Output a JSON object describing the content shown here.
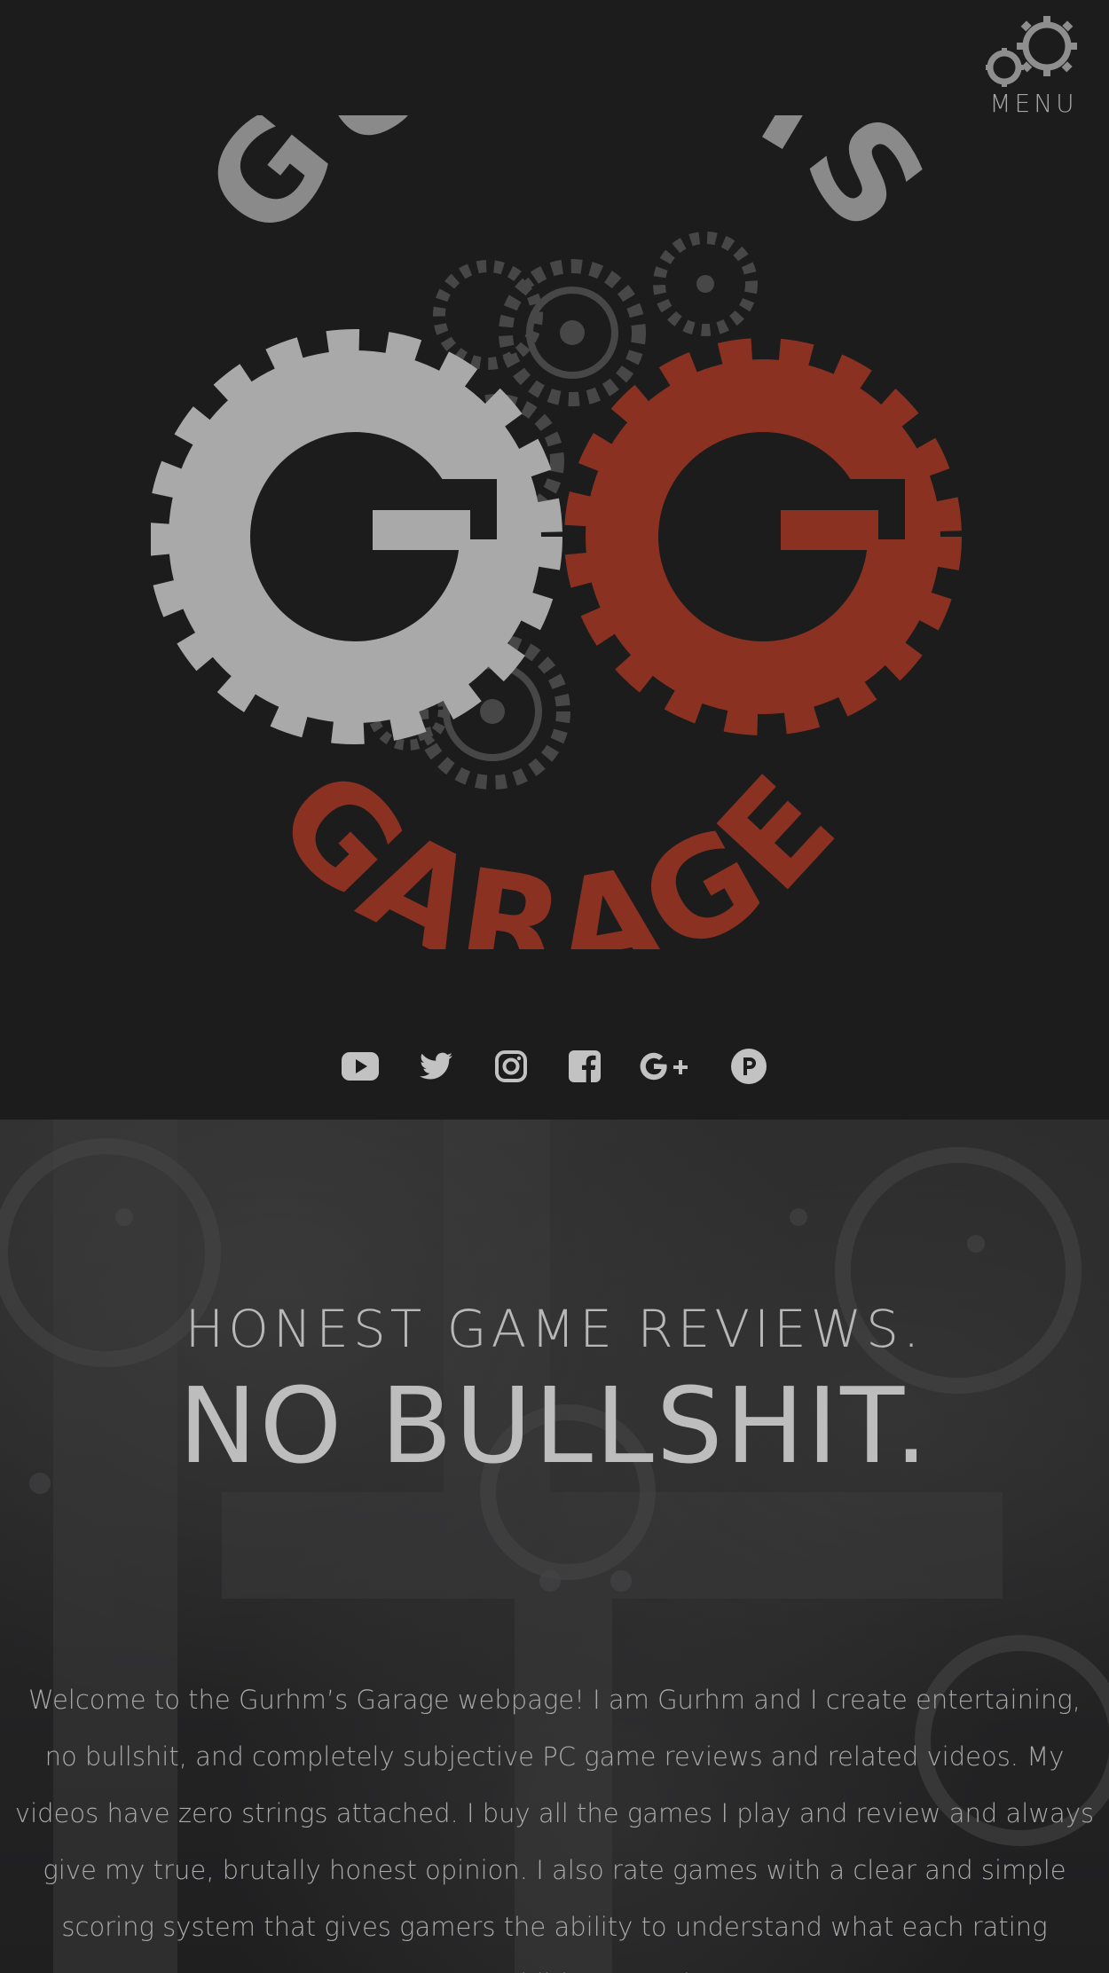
{
  "header": {
    "menu_label": "MENU",
    "menu_icon": "gears-icon"
  },
  "logo": {
    "top_text": "GURHMS",
    "bottom_text": "GARAGE",
    "monogram": "GG",
    "colors": {
      "grey": "#8a8a8a",
      "light_grey": "#a9a9a9",
      "red": "#8a3122",
      "dark_gear": "#474747"
    }
  },
  "social": [
    {
      "name": "youtube-icon"
    },
    {
      "name": "twitter-icon"
    },
    {
      "name": "instagram-icon"
    },
    {
      "name": "facebook-icon"
    },
    {
      "name": "google-plus-icon"
    },
    {
      "name": "patreon-icon"
    }
  ],
  "hero": {
    "tagline": "HONEST GAME REVIEWS.",
    "headline": "NO BULLSHIT.",
    "intro": "Welcome to the Gurhm’s Garage webpage! I am Gurhm and I create entertaining, no bullshit, and completely subjective PC game reviews and related videos. My videos have zero strings attached. I buy all the games I play and review and always give my true, brutally honest opinion. I also rate games with a clear and simple scoring system that gives gamers the ability to understand what each rating means. In addition to reviews,"
  },
  "colors": {
    "background": "#1c1c1d",
    "text": "#b3b3b3",
    "icon": "#c2c2c2"
  }
}
